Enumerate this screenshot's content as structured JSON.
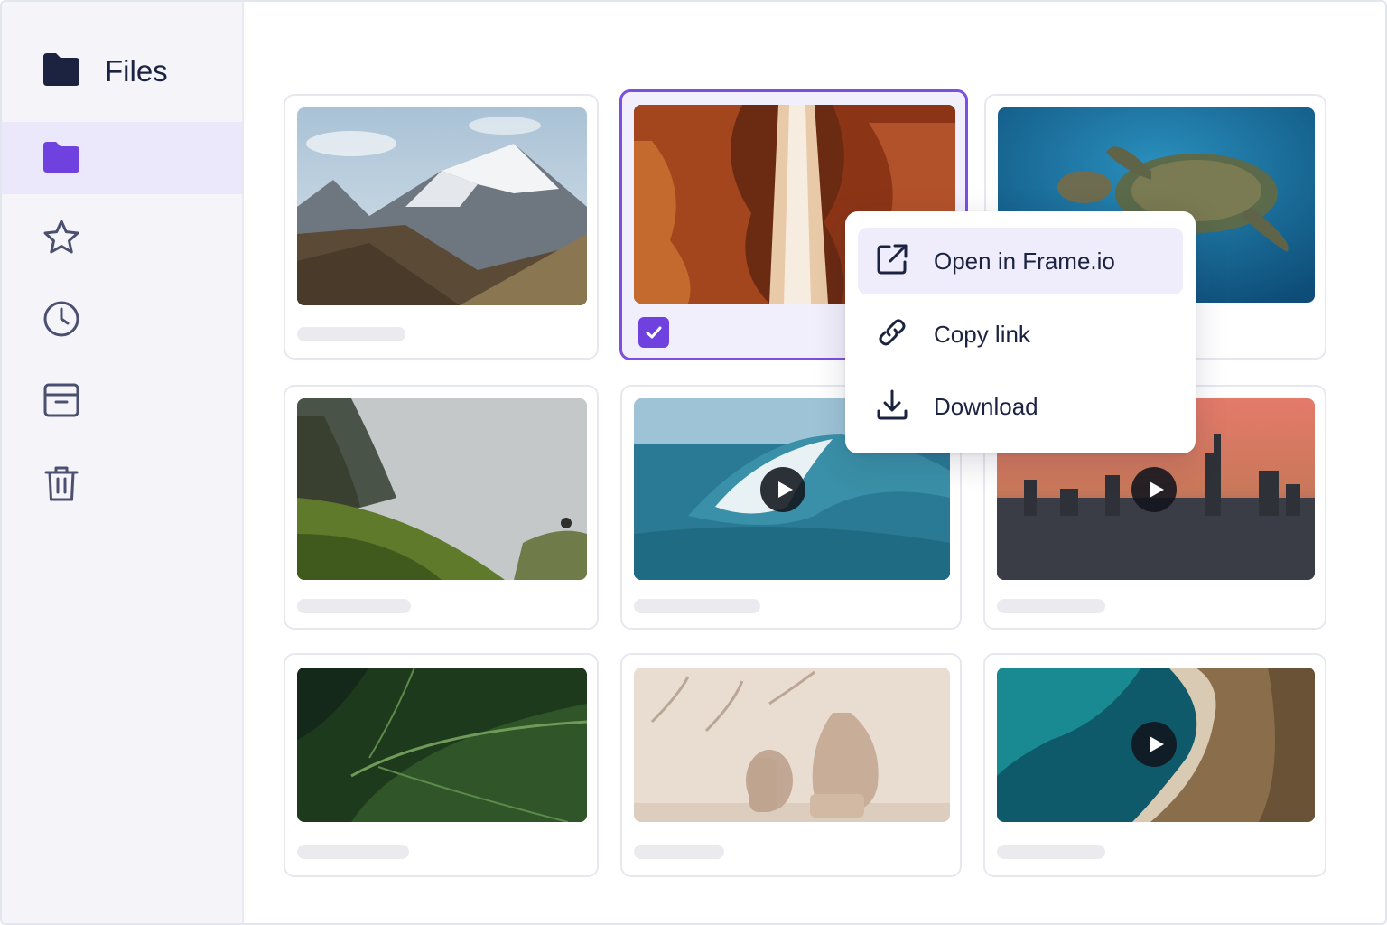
{
  "sidebar": {
    "title": "Files",
    "items": [
      {
        "icon": "folder-icon",
        "active": true
      },
      {
        "icon": "star-icon",
        "active": false
      },
      {
        "icon": "clock-icon",
        "active": false
      },
      {
        "icon": "archive-icon",
        "active": false
      },
      {
        "icon": "trash-icon",
        "active": false
      }
    ]
  },
  "grid": {
    "items": [
      {
        "subject": "mountain",
        "type": "image",
        "selected": false
      },
      {
        "subject": "canyon",
        "type": "image",
        "selected": true
      },
      {
        "subject": "sea-turtle",
        "type": "image",
        "selected": false
      },
      {
        "subject": "foggy-hillside",
        "type": "image",
        "selected": false
      },
      {
        "subject": "surfer-wave",
        "type": "video",
        "selected": false
      },
      {
        "subject": "city-skyline",
        "type": "video",
        "selected": false
      },
      {
        "subject": "leaf",
        "type": "image",
        "selected": false
      },
      {
        "subject": "vases",
        "type": "image",
        "selected": false
      },
      {
        "subject": "aerial-coast",
        "type": "video",
        "selected": false
      }
    ]
  },
  "context_menu": {
    "items": [
      {
        "label": "Open in Frame.io",
        "icon": "external-link-icon",
        "highlighted": true
      },
      {
        "label": "Copy link",
        "icon": "link-icon",
        "highlighted": false
      },
      {
        "label": "Download",
        "icon": "download-icon",
        "highlighted": false
      }
    ]
  },
  "colors": {
    "accent": "#6f42e0",
    "selected_border": "#7c4fe0",
    "active_nav_bg": "#ece8fb",
    "text_dark": "#1b2341"
  }
}
